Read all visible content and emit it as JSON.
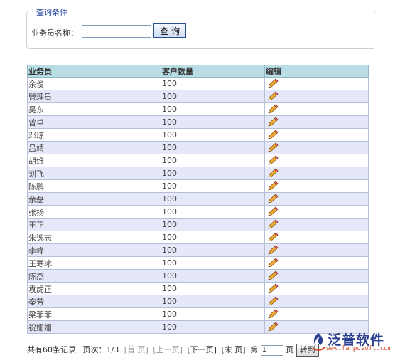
{
  "query": {
    "legend": "查询条件",
    "label": "业务员名称：",
    "input_value": "",
    "button_label": "查询"
  },
  "table": {
    "headers": [
      "业务员",
      "客户数量",
      "编辑"
    ],
    "rows": [
      {
        "name": "余俊",
        "count": "100"
      },
      {
        "name": "管理员",
        "count": "100"
      },
      {
        "name": "吴东",
        "count": "100"
      },
      {
        "name": "曾卓",
        "count": "100"
      },
      {
        "name": "邓琼",
        "count": "100"
      },
      {
        "name": "吕靖",
        "count": "100"
      },
      {
        "name": "胡维",
        "count": "100"
      },
      {
        "name": "刘飞",
        "count": "100"
      },
      {
        "name": "陈鹏",
        "count": "100"
      },
      {
        "name": "余磊",
        "count": "100"
      },
      {
        "name": "张扬",
        "count": "100"
      },
      {
        "name": "王正",
        "count": "100"
      },
      {
        "name": "朱逸志",
        "count": "100"
      },
      {
        "name": "李峰",
        "count": "100"
      },
      {
        "name": "王寒冰",
        "count": "100"
      },
      {
        "name": "陈杰",
        "count": "100"
      },
      {
        "name": "袁虎正",
        "count": "100"
      },
      {
        "name": "秦芳",
        "count": "100"
      },
      {
        "name": "梁菲菲",
        "count": "100"
      },
      {
        "name": "祝姗姗",
        "count": "100"
      }
    ],
    "edit_icon": "pencil-icon"
  },
  "pager": {
    "total": "共有60条记录",
    "page_info": "页次：1/3",
    "first": "[首 页]",
    "prev": "[上一页]",
    "next": "[下一页]",
    "last": "[末 页]",
    "goto_prefix": "第",
    "goto_value": "1",
    "goto_suffix": "页",
    "goto_button": "转到"
  },
  "brand": {
    "name": "泛普软件",
    "url": "www.fanpusoft.com"
  },
  "colors": {
    "header_bg": "#b9dde4",
    "row_alt_bg": "#e4e8f8",
    "legend_text": "#1a3f9e",
    "brand_text": "#2a3f8f",
    "brand_url": "#d04a2a"
  }
}
